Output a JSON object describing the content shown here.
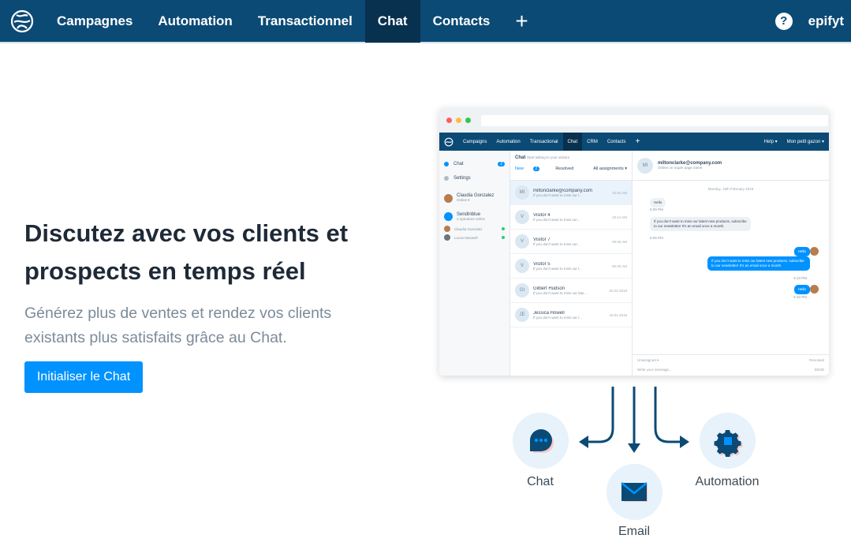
{
  "nav": {
    "items": [
      "Campagnes",
      "Automation",
      "Transactionnel",
      "Chat",
      "Contacts"
    ],
    "plus": "+",
    "help": "?",
    "account": "epifyt"
  },
  "hero": {
    "title": "Discutez avec vos clients et prospects en temps réel",
    "subtitle": "Générez plus de ventes et rendez vos clients existants plus satisfaits grâce au Chat.",
    "cta": "Initialiser le Chat"
  },
  "mock": {
    "nav": [
      "Campaigns",
      "Automation",
      "Transactional",
      "Chat",
      "CRM",
      "Contacts"
    ],
    "nav_plus": "+",
    "nav_help": "Help ▾",
    "nav_account": "Mon petit gazon ▾",
    "left": {
      "chat_label": "Chat",
      "chat_badge": "2",
      "settings_label": "Settings",
      "me_name": "Claudia Gonzalez",
      "me_status": "Online ▾",
      "team_name": "Sendinblue",
      "team_status": "2 operators online",
      "operators": [
        "Claudia Gonzalez",
        "Lucas Maxwell"
      ]
    },
    "middle": {
      "title": "Chat",
      "title_hint": "Start talking to your visitors",
      "tab_new": "New",
      "tab_new_count": "2",
      "tab_resolved": "Resolved",
      "tab_all": "All assignments ▾",
      "conversations": [
        {
          "initials": "MI",
          "name": "miltonclarke@company.com",
          "preview": "If you don't want to miss our l...",
          "time": "10:34 AM"
        },
        {
          "initials": "V",
          "name": "Visitor 4",
          "preview": "If you don't want to miss our...",
          "time": "10:14 AM"
        },
        {
          "initials": "V",
          "name": "Visitor 7",
          "preview": "If you don't want to miss our...",
          "time": "09:45 AM"
        },
        {
          "initials": "V",
          "name": "Visitor 5",
          "preview": "If you don't want to miss our l...",
          "time": "06:45 AM"
        },
        {
          "initials": "GI",
          "name": "Gilbert Hudson",
          "preview": "If you don't want to miss our late...",
          "time": "02.02.2018"
        },
        {
          "initials": "JE",
          "name": "Jessica Howell",
          "preview": "If you don't want to miss our l...",
          "time": "18.01.2018"
        }
      ]
    },
    "right": {
      "initials": "MI",
      "contact": "miltonclarke@company.com",
      "contact_status": "Online on Super page name",
      "date": "Monday, 19th February 2018",
      "msg_in_1": "Hello",
      "msg_in_1_time": "5:09 PM",
      "msg_in_2": "If you don't want to miss our latest new products, subscribe to our newsletter! It's an email once a month.",
      "msg_in_2_time": "5:09 PM",
      "msg_out_1": "Hello",
      "msg_out_2": "If you don't want to miss our latest new products, subscribe to our newsletter! It's an email once a month.",
      "msg_out_2_time": "5:10 PM",
      "msg_out_3": "Hello",
      "msg_out_3_time": "5:10 PM",
      "unassigned": "Unassigned ▾",
      "resolved": "Resolved",
      "placeholder": "Write your message...",
      "send": "SEND"
    }
  },
  "features": {
    "chat": "Chat",
    "email": "Email",
    "automation": "Automation"
  },
  "colors": {
    "nav": "#0b4a75",
    "nav_active": "#08304f",
    "accent": "#0092ff",
    "circle": "#e7f2fb"
  }
}
